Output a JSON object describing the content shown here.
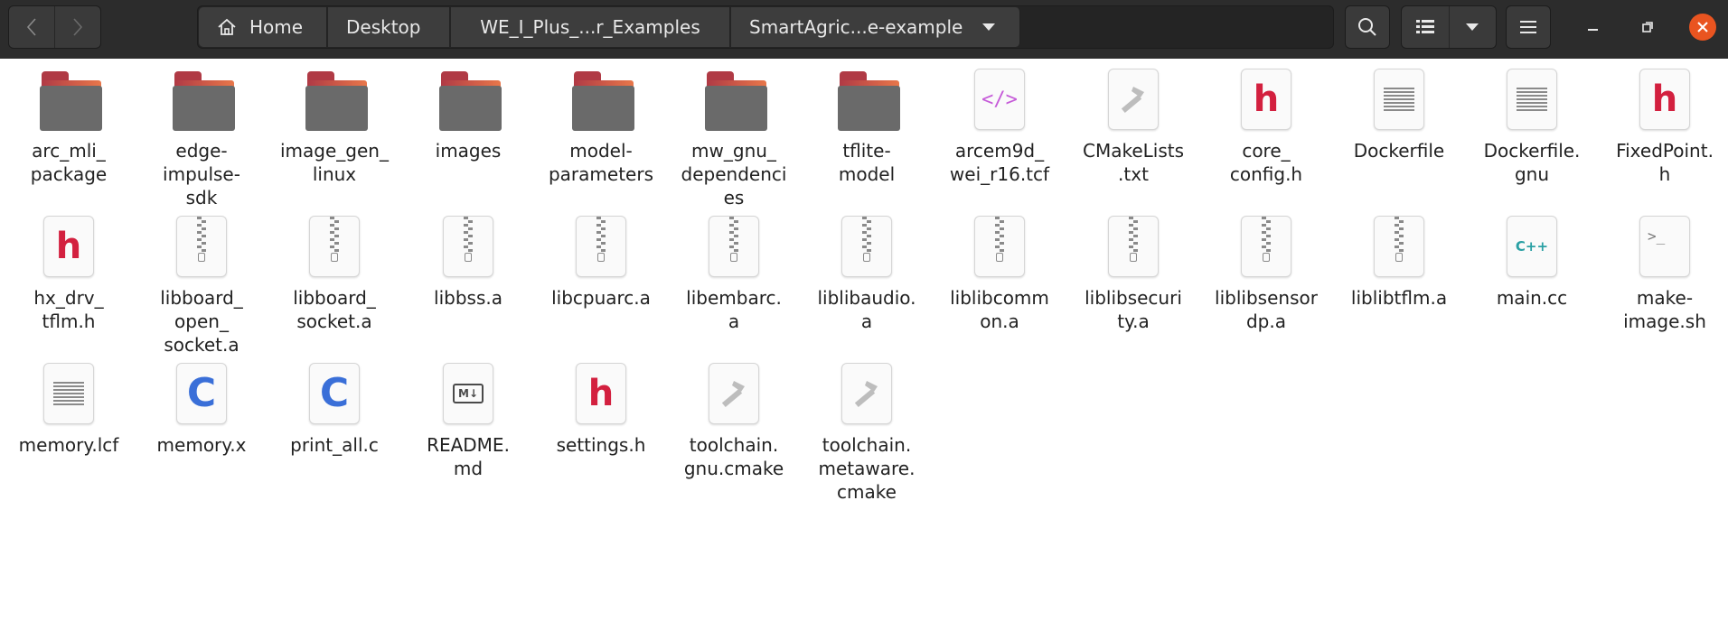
{
  "header": {
    "breadcrumbs": [
      "Home",
      "Desktop",
      "WE_I_Plus_...r_Examples",
      "SmartAgric...e-example"
    ],
    "accent_close": "#e95420"
  },
  "files": [
    {
      "name": "arc_mli_\npackage",
      "type": "folder"
    },
    {
      "name": "edge-\nimpulse-\nsdk",
      "type": "folder"
    },
    {
      "name": "image_gen_\nlinux",
      "type": "folder"
    },
    {
      "name": "images",
      "type": "folder"
    },
    {
      "name": "model-\nparameters",
      "type": "folder"
    },
    {
      "name": "mw_gnu_\ndependenci\nes",
      "type": "folder"
    },
    {
      "name": "tflite-\nmodel",
      "type": "folder"
    },
    {
      "name": "arcem9d_\nwei_r16.tcf",
      "type": "xml"
    },
    {
      "name": "CMakeLists\n.txt",
      "type": "cmake"
    },
    {
      "name": "core_\nconfig.h",
      "type": "header"
    },
    {
      "name": "Dockerfile",
      "type": "text"
    },
    {
      "name": "Dockerfile.\ngnu",
      "type": "text"
    },
    {
      "name": "FixedPoint.\nh",
      "type": "header"
    },
    {
      "name": "hx_drv_\ntflm.h",
      "type": "header"
    },
    {
      "name": "libboard_\nopen_\nsocket.a",
      "type": "archive"
    },
    {
      "name": "libboard_\nsocket.a",
      "type": "archive"
    },
    {
      "name": "libbss.a",
      "type": "archive"
    },
    {
      "name": "libcpuarc.a",
      "type": "archive"
    },
    {
      "name": "libembarc.\na",
      "type": "archive"
    },
    {
      "name": "liblibaudio.\na",
      "type": "archive"
    },
    {
      "name": "liblibcomm\non.a",
      "type": "archive"
    },
    {
      "name": "liblibsecuri\nty.a",
      "type": "archive"
    },
    {
      "name": "liblibsensor\ndp.a",
      "type": "archive"
    },
    {
      "name": "liblibtflm.a",
      "type": "archive"
    },
    {
      "name": "main.cc",
      "type": "cpp"
    },
    {
      "name": "make-\nimage.sh",
      "type": "shell"
    },
    {
      "name": "memory.lcf",
      "type": "text"
    },
    {
      "name": "memory.x",
      "type": "csource"
    },
    {
      "name": "print_all.c",
      "type": "csource"
    },
    {
      "name": "README.\nmd",
      "type": "markdown"
    },
    {
      "name": "settings.h",
      "type": "header"
    },
    {
      "name": "toolchain.\ngnu.cmake",
      "type": "cmake"
    },
    {
      "name": "toolchain.\nmetaware.\ncmake",
      "type": "cmake"
    }
  ],
  "glyphs": {
    "header": "h",
    "csource": "C",
    "cpp": "C++",
    "xml": "</>",
    "shell": ">_",
    "markdown": "M↓"
  }
}
